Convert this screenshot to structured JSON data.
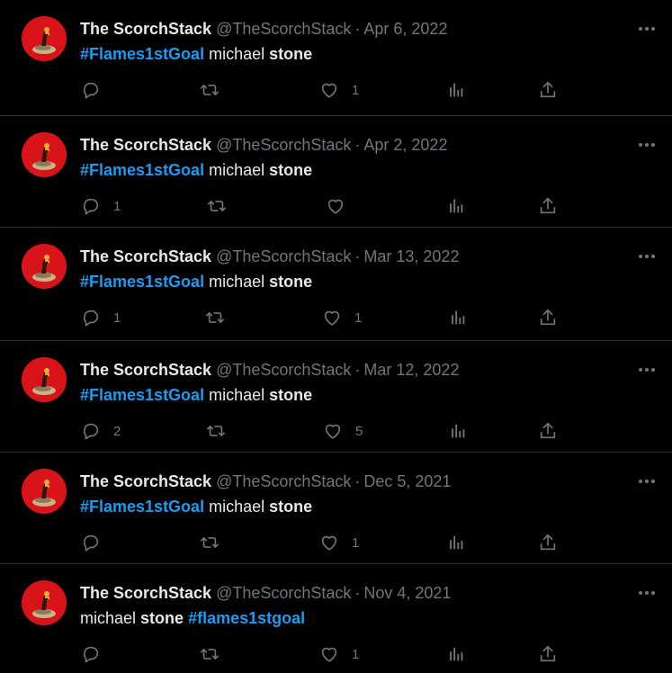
{
  "colors": {
    "accent": "#1d9bf0",
    "muted": "#71767b",
    "background": "#000000",
    "avatar": "#d8141a"
  },
  "tweets": [
    {
      "name": "The ScorchStack",
      "handle": "@TheScorchStack",
      "sep": "·",
      "date": "Apr 6, 2022",
      "text": [
        {
          "t": "#Flames1stGoal",
          "c": "hashtag"
        },
        {
          "t": " michael ",
          "c": "plain"
        },
        {
          "t": "stone",
          "c": "bold"
        }
      ],
      "replies": "",
      "retweets": "",
      "likes": "1"
    },
    {
      "name": "The ScorchStack",
      "handle": "@TheScorchStack",
      "sep": "·",
      "date": "Apr 2, 2022",
      "text": [
        {
          "t": "#Flames1stGoal",
          "c": "hashtag"
        },
        {
          "t": " michael ",
          "c": "plain"
        },
        {
          "t": "stone",
          "c": "bold"
        }
      ],
      "replies": "1",
      "retweets": "",
      "likes": ""
    },
    {
      "name": "The ScorchStack",
      "handle": "@TheScorchStack",
      "sep": "·",
      "date": "Mar 13, 2022",
      "text": [
        {
          "t": "#Flames1stGoal",
          "c": "hashtag"
        },
        {
          "t": " michael ",
          "c": "plain"
        },
        {
          "t": "stone",
          "c": "bold"
        }
      ],
      "replies": "1",
      "retweets": "",
      "likes": "1"
    },
    {
      "name": "The ScorchStack",
      "handle": "@TheScorchStack",
      "sep": "·",
      "date": "Mar 12, 2022",
      "text": [
        {
          "t": "#Flames1stGoal",
          "c": "hashtag"
        },
        {
          "t": " michael ",
          "c": "plain"
        },
        {
          "t": "stone",
          "c": "bold"
        }
      ],
      "replies": "2",
      "retweets": "",
      "likes": "5"
    },
    {
      "name": "The ScorchStack",
      "handle": "@TheScorchStack",
      "sep": "·",
      "date": "Dec 5, 2021",
      "text": [
        {
          "t": "#Flames1stGoal",
          "c": "hashtag"
        },
        {
          "t": " michael ",
          "c": "plain"
        },
        {
          "t": "stone",
          "c": "bold"
        }
      ],
      "replies": "",
      "retweets": "",
      "likes": "1"
    },
    {
      "name": "The ScorchStack",
      "handle": "@TheScorchStack",
      "sep": "·",
      "date": "Nov 4, 2021",
      "text": [
        {
          "t": "michael ",
          "c": "plain"
        },
        {
          "t": "stone",
          "c": "bold"
        },
        {
          "t": " ",
          "c": "plain"
        },
        {
          "t": "#flames1stgoal",
          "c": "hashtag"
        }
      ],
      "replies": "",
      "retweets": "",
      "likes": "1"
    }
  ]
}
